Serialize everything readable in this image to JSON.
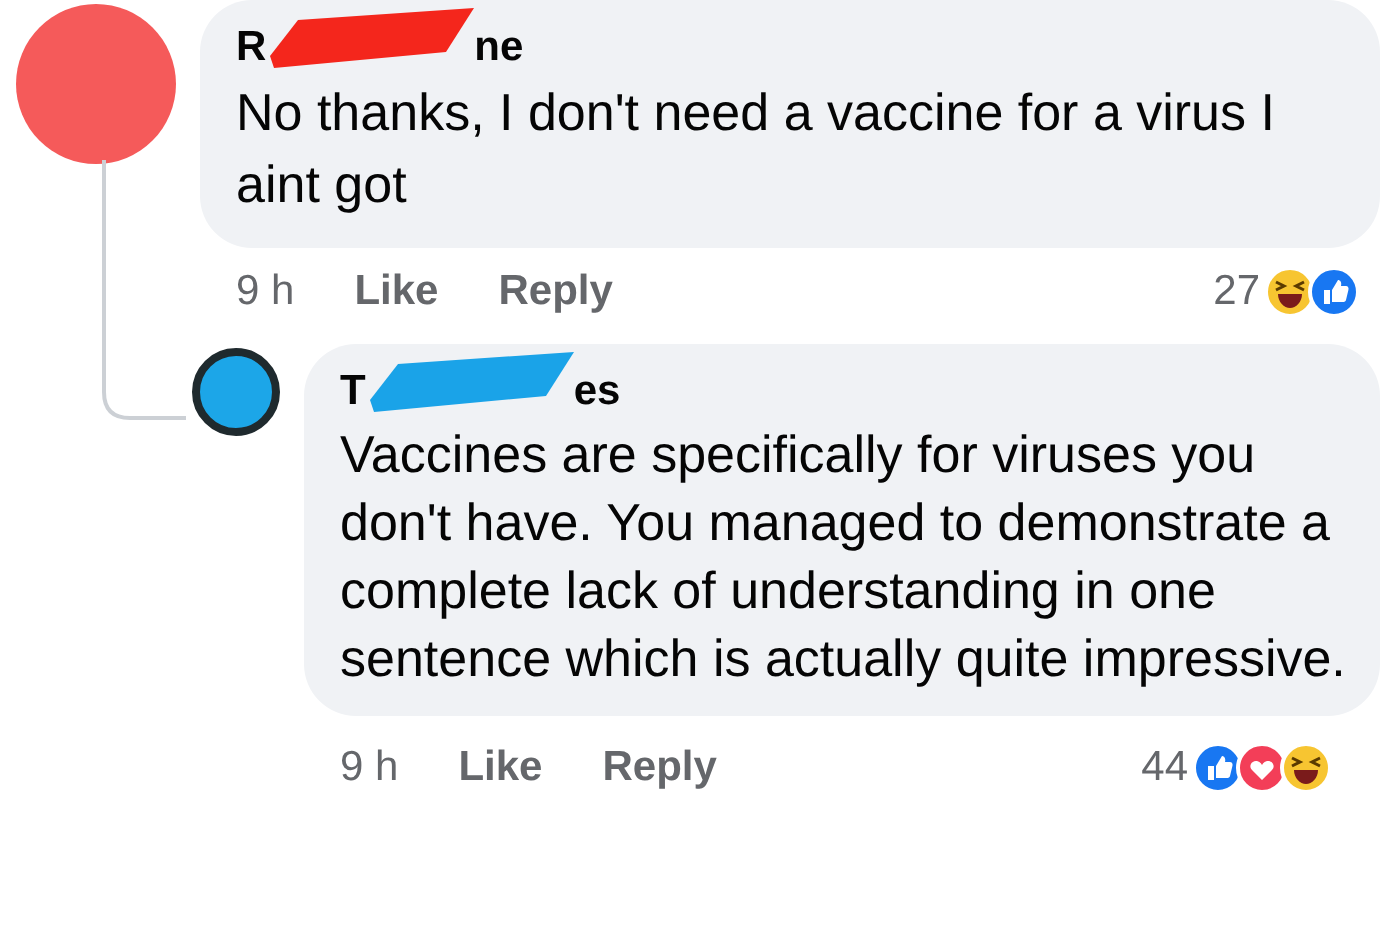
{
  "comment": {
    "name_parts": [
      "R",
      "ne"
    ],
    "text": "No thanks, I don't need a vaccine for a virus I aint got",
    "time": "9 h",
    "actions": [
      "Like",
      "Reply"
    ],
    "reaction_count": "27",
    "reactions": [
      {
        "kind": "haha"
      },
      {
        "kind": "like"
      }
    ],
    "replies": [
      {
        "name_parts": [
          "T",
          "es"
        ],
        "text": "Vaccines are specifically for viruses you don't have. You managed to demonstrate a complete lack of understanding in one sentence which is actually quite impressive.",
        "time": "9 h",
        "actions": [
          "Like",
          "Reply"
        ],
        "reaction_count": "44",
        "reactions": [
          {
            "kind": "like"
          },
          {
            "kind": "love"
          },
          {
            "kind": "haha"
          }
        ]
      }
    ]
  }
}
